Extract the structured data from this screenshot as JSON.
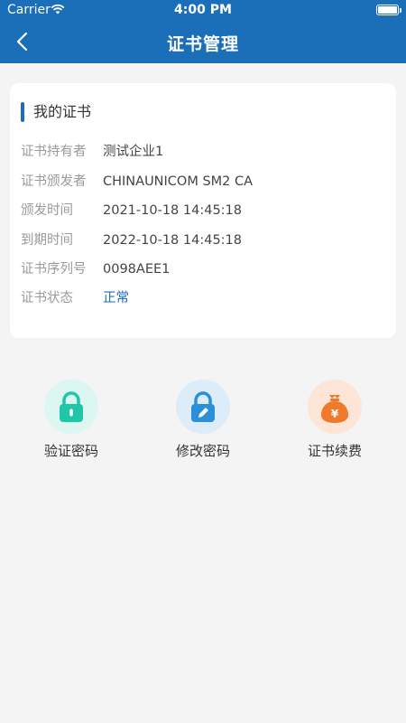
{
  "status_bar": {
    "carrier": "Carrier",
    "time": "4:00 PM"
  },
  "nav": {
    "title": "证书管理"
  },
  "card": {
    "title": "我的证书",
    "rows": [
      {
        "label": "证书持有者",
        "value": "测试企业1"
      },
      {
        "label": "证书颁发者",
        "value": "CHINAUNICOM SM2 CA"
      },
      {
        "label": "颁发时间",
        "value": "2021-10-18 14:45:18"
      },
      {
        "label": "到期时间",
        "value": "2022-10-18 14:45:18"
      },
      {
        "label": "证书序列号",
        "value": "0098AEE1"
      },
      {
        "label": "证书状态",
        "value": "正常"
      }
    ]
  },
  "actions": [
    {
      "label": "验证密码",
      "icon": "lock-icon",
      "color": "#1fc6a8",
      "bg": "#dcf7f2"
    },
    {
      "label": "修改密码",
      "icon": "lock-edit-icon",
      "color": "#2a90d9",
      "bg": "#dcedf9"
    },
    {
      "label": "证书续费",
      "icon": "money-bag-icon",
      "color": "#f07a2c",
      "bg": "#fde6d8"
    }
  ],
  "colors": {
    "header": "#1b6fb8",
    "accent": "#1b6fb8",
    "status_ok": "#1b6fb8"
  }
}
